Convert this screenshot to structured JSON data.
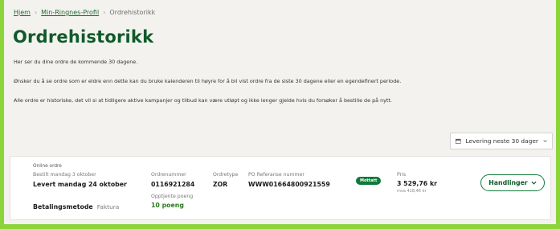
{
  "breadcrumb": {
    "items": [
      {
        "label": "Hjem"
      },
      {
        "label": "Min-Ringnes-Profil"
      },
      {
        "label": "Ordrehistorikk"
      }
    ],
    "separator": "›"
  },
  "page": {
    "title": "Ordrehistorikk",
    "paragraphs": [
      "Her ser du dine ordre de kommende 30 dagene.",
      "Ønsker du å se ordre som er eldre enn dette kan du bruke kalenderen til høyre for å bil vist ordre fra de siste 30 dagene eller en egendefinert periode.",
      "Alle ordre er historiske, det vil si at tidligere aktive kampanjer og tilbud kan være utløpt og ikke lenger gjelde hvis du forsøker å bestille de på nytt."
    ]
  },
  "filter": {
    "label": "Levering neste 30 dager",
    "icon": "calendar-icon",
    "chevron": "chevron-down-icon"
  },
  "order": {
    "type_label": "Online ordre",
    "ordered": "Bestilt mandag 3 oktober",
    "delivered": "Levert mandag 24 oktober",
    "payment_label": "Betalingsmetode",
    "payment_value": "Faktura",
    "ordernumber_label": "Ordrenummer",
    "ordernumber_value": "0116921284",
    "points_label": "Opptjente poeng",
    "points_value": "10 poeng",
    "ordertype_label": "Ordretype",
    "ordertype_value": "ZOR",
    "po_label": "PO Referanse nummer",
    "po_value": "WWW01664800921559",
    "status_badge": "Mottatt",
    "price_label": "Pris",
    "price_value": "3 529,76 kr",
    "price_vat": "mva 418,46 kr",
    "actions_label": "Handlinger"
  },
  "colors": {
    "accent": "#8bd43a",
    "brand_dark": "#0f5a2a",
    "badge_bg": "#0f7a3a",
    "page_bg": "#f3f2ee"
  }
}
